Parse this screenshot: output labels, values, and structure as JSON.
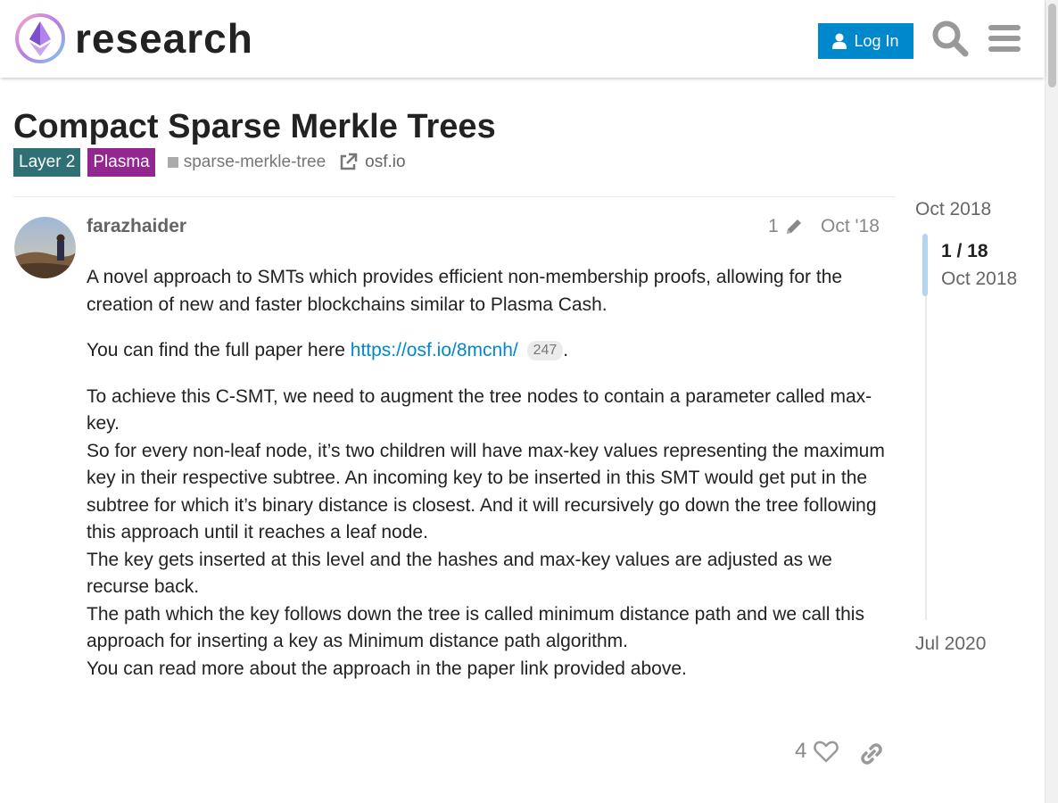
{
  "header": {
    "logo_text": "research",
    "login_label": "Log In",
    "search_icon": "search-icon",
    "menu_icon": "hamburger-menu-icon",
    "accent_color": "#0088cc"
  },
  "topic": {
    "title": "Compact Sparse Merkle Trees",
    "categories": [
      {
        "label": "Layer 2",
        "color": "#2e7073"
      },
      {
        "label": "Plasma",
        "color": "#92278f"
      }
    ],
    "tag": "sparse-merkle-tree",
    "external_link": "osf.io"
  },
  "post": {
    "username": "farazhaider",
    "edit_count": "1",
    "date": "Oct '18",
    "paragraphs": {
      "p1": "A novel approach to SMTs which provides efficient non-membership proofs, allowing for the creation of new and faster blockchains similar to Plasma Cash.",
      "p2_prefix": "You can find the full paper here ",
      "p2_link": "https://osf.io/8mcnh/",
      "p2_clicks": "247",
      "p2_suffix": ".",
      "p3": "To achieve this C-SMT, we need to augment the tree nodes to contain a parameter called max-key.",
      "p4": "So for every non-leaf node, it’s two children will have max-key values representing the maximum key in their respective subtree. An incoming key to be inserted in this SMT would get put in the subtree for which it’s binary distance is closest. And it will recursively go down the tree following this approach until it reaches a leaf node.",
      "p5": "The key gets inserted at this level and the hashes and max-key values are adjusted as we recurse back.",
      "p6": "The path which the key follows down the tree is called minimum distance path and we call this approach for inserting a key as Minimum distance path algorithm.",
      "p7": "You can read more about the approach in the paper link provided above."
    },
    "likes": "4"
  },
  "timeline": {
    "start": "Oct 2018",
    "position": "1 / 18",
    "position_date": "Oct 2018",
    "end": "Jul 2020"
  }
}
